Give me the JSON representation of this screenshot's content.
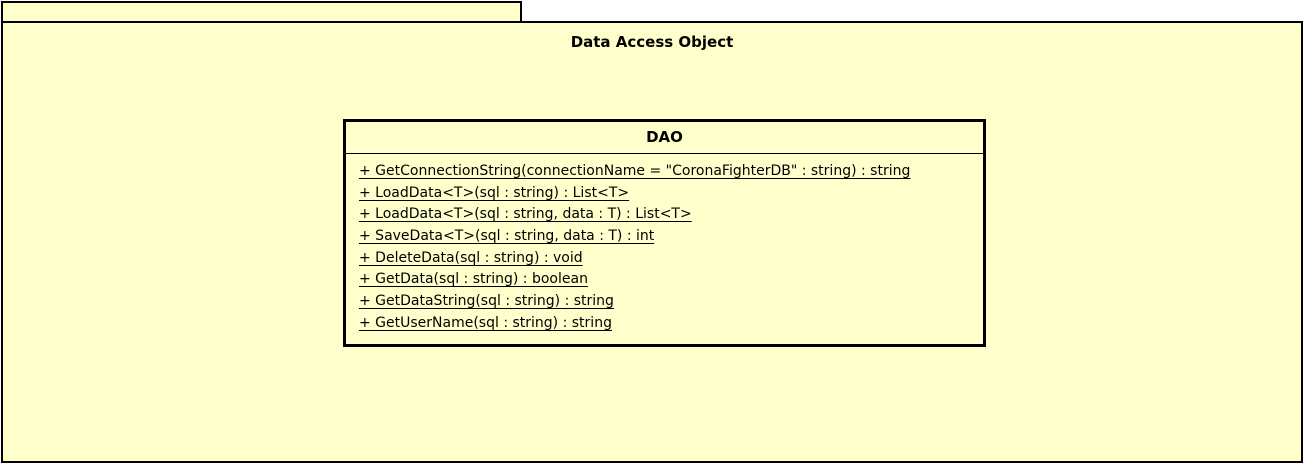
{
  "package": {
    "title": "Data Access Object"
  },
  "class": {
    "name": "DAO",
    "operations": [
      "+ GetConnectionString(connectionName = \"CoronaFighterDB\" : string) : string",
      "+ LoadData<T>(sql : string) : List<T>",
      "+ LoadData<T>(sql : string, data : T) : List<T>",
      "+ SaveData<T>(sql : string, data : T) : int",
      "+ DeleteData(sql : string) : void",
      "+ GetData(sql : string) : boolean",
      "+ GetDataString(sql : string) : string",
      "+ GetUserName(sql : string) : string"
    ]
  }
}
